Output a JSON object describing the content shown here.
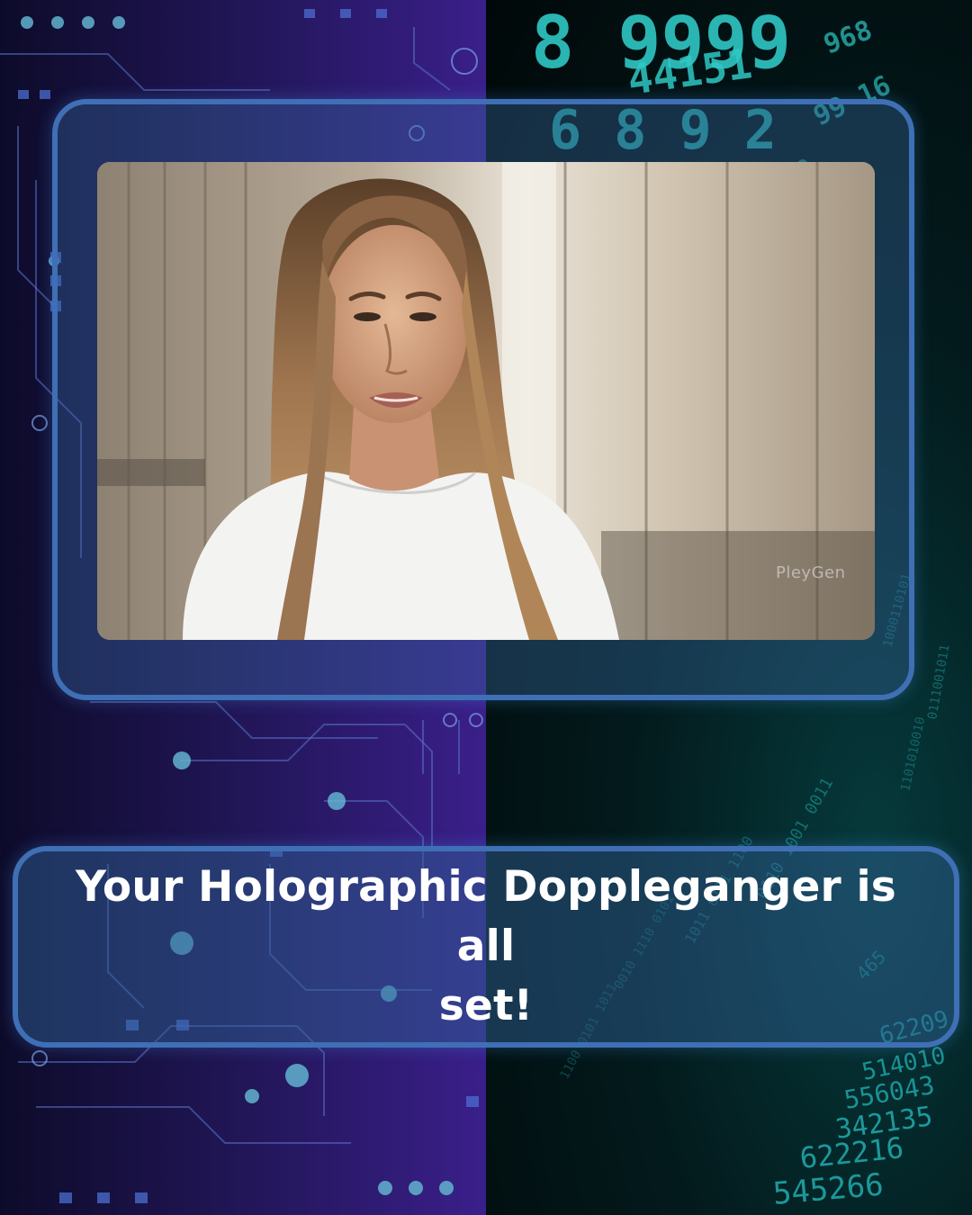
{
  "caption": {
    "line1": "Your Holographic Doppleganger is all",
    "line2": "set!"
  },
  "video": {
    "watermark": "PleyGen",
    "subject": "woman in white t-shirt speaking"
  },
  "background": {
    "left_style": "purple circuit board",
    "right_style": "teal digital number stream"
  },
  "colors": {
    "frame_border": "#3f6fb5",
    "left_accent": "#3a1f8a",
    "right_accent": "#1fa5a8",
    "text": "#ffffff"
  }
}
